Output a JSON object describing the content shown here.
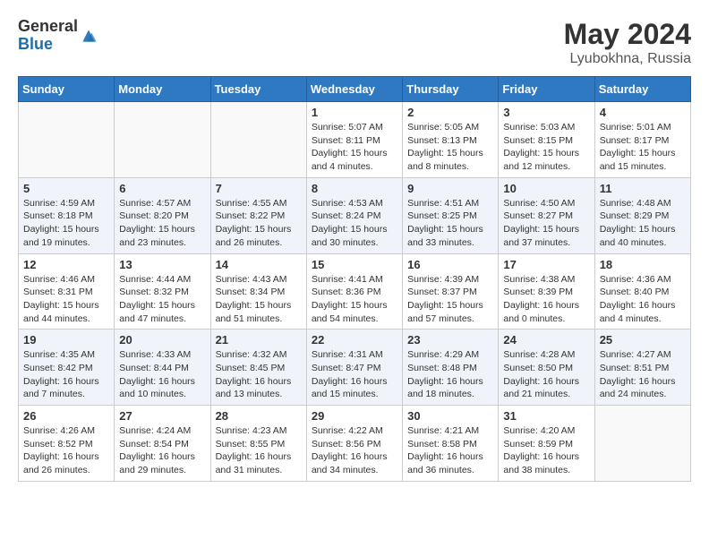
{
  "logo": {
    "general": "General",
    "blue": "Blue"
  },
  "title": "May 2024",
  "location": "Lyubokhna, Russia",
  "days_of_week": [
    "Sunday",
    "Monday",
    "Tuesday",
    "Wednesday",
    "Thursday",
    "Friday",
    "Saturday"
  ],
  "weeks": [
    [
      {
        "day": "",
        "sunrise": "",
        "sunset": "",
        "daylight": ""
      },
      {
        "day": "",
        "sunrise": "",
        "sunset": "",
        "daylight": ""
      },
      {
        "day": "",
        "sunrise": "",
        "sunset": "",
        "daylight": ""
      },
      {
        "day": "1",
        "sunrise": "Sunrise: 5:07 AM",
        "sunset": "Sunset: 8:11 PM",
        "daylight": "Daylight: 15 hours and 4 minutes."
      },
      {
        "day": "2",
        "sunrise": "Sunrise: 5:05 AM",
        "sunset": "Sunset: 8:13 PM",
        "daylight": "Daylight: 15 hours and 8 minutes."
      },
      {
        "day": "3",
        "sunrise": "Sunrise: 5:03 AM",
        "sunset": "Sunset: 8:15 PM",
        "daylight": "Daylight: 15 hours and 12 minutes."
      },
      {
        "day": "4",
        "sunrise": "Sunrise: 5:01 AM",
        "sunset": "Sunset: 8:17 PM",
        "daylight": "Daylight: 15 hours and 15 minutes."
      }
    ],
    [
      {
        "day": "5",
        "sunrise": "Sunrise: 4:59 AM",
        "sunset": "Sunset: 8:18 PM",
        "daylight": "Daylight: 15 hours and 19 minutes."
      },
      {
        "day": "6",
        "sunrise": "Sunrise: 4:57 AM",
        "sunset": "Sunset: 8:20 PM",
        "daylight": "Daylight: 15 hours and 23 minutes."
      },
      {
        "day": "7",
        "sunrise": "Sunrise: 4:55 AM",
        "sunset": "Sunset: 8:22 PM",
        "daylight": "Daylight: 15 hours and 26 minutes."
      },
      {
        "day": "8",
        "sunrise": "Sunrise: 4:53 AM",
        "sunset": "Sunset: 8:24 PM",
        "daylight": "Daylight: 15 hours and 30 minutes."
      },
      {
        "day": "9",
        "sunrise": "Sunrise: 4:51 AM",
        "sunset": "Sunset: 8:25 PM",
        "daylight": "Daylight: 15 hours and 33 minutes."
      },
      {
        "day": "10",
        "sunrise": "Sunrise: 4:50 AM",
        "sunset": "Sunset: 8:27 PM",
        "daylight": "Daylight: 15 hours and 37 minutes."
      },
      {
        "day": "11",
        "sunrise": "Sunrise: 4:48 AM",
        "sunset": "Sunset: 8:29 PM",
        "daylight": "Daylight: 15 hours and 40 minutes."
      }
    ],
    [
      {
        "day": "12",
        "sunrise": "Sunrise: 4:46 AM",
        "sunset": "Sunset: 8:31 PM",
        "daylight": "Daylight: 15 hours and 44 minutes."
      },
      {
        "day": "13",
        "sunrise": "Sunrise: 4:44 AM",
        "sunset": "Sunset: 8:32 PM",
        "daylight": "Daylight: 15 hours and 47 minutes."
      },
      {
        "day": "14",
        "sunrise": "Sunrise: 4:43 AM",
        "sunset": "Sunset: 8:34 PM",
        "daylight": "Daylight: 15 hours and 51 minutes."
      },
      {
        "day": "15",
        "sunrise": "Sunrise: 4:41 AM",
        "sunset": "Sunset: 8:36 PM",
        "daylight": "Daylight: 15 hours and 54 minutes."
      },
      {
        "day": "16",
        "sunrise": "Sunrise: 4:39 AM",
        "sunset": "Sunset: 8:37 PM",
        "daylight": "Daylight: 15 hours and 57 minutes."
      },
      {
        "day": "17",
        "sunrise": "Sunrise: 4:38 AM",
        "sunset": "Sunset: 8:39 PM",
        "daylight": "Daylight: 16 hours and 0 minutes."
      },
      {
        "day": "18",
        "sunrise": "Sunrise: 4:36 AM",
        "sunset": "Sunset: 8:40 PM",
        "daylight": "Daylight: 16 hours and 4 minutes."
      }
    ],
    [
      {
        "day": "19",
        "sunrise": "Sunrise: 4:35 AM",
        "sunset": "Sunset: 8:42 PM",
        "daylight": "Daylight: 16 hours and 7 minutes."
      },
      {
        "day": "20",
        "sunrise": "Sunrise: 4:33 AM",
        "sunset": "Sunset: 8:44 PM",
        "daylight": "Daylight: 16 hours and 10 minutes."
      },
      {
        "day": "21",
        "sunrise": "Sunrise: 4:32 AM",
        "sunset": "Sunset: 8:45 PM",
        "daylight": "Daylight: 16 hours and 13 minutes."
      },
      {
        "day": "22",
        "sunrise": "Sunrise: 4:31 AM",
        "sunset": "Sunset: 8:47 PM",
        "daylight": "Daylight: 16 hours and 15 minutes."
      },
      {
        "day": "23",
        "sunrise": "Sunrise: 4:29 AM",
        "sunset": "Sunset: 8:48 PM",
        "daylight": "Daylight: 16 hours and 18 minutes."
      },
      {
        "day": "24",
        "sunrise": "Sunrise: 4:28 AM",
        "sunset": "Sunset: 8:50 PM",
        "daylight": "Daylight: 16 hours and 21 minutes."
      },
      {
        "day": "25",
        "sunrise": "Sunrise: 4:27 AM",
        "sunset": "Sunset: 8:51 PM",
        "daylight": "Daylight: 16 hours and 24 minutes."
      }
    ],
    [
      {
        "day": "26",
        "sunrise": "Sunrise: 4:26 AM",
        "sunset": "Sunset: 8:52 PM",
        "daylight": "Daylight: 16 hours and 26 minutes."
      },
      {
        "day": "27",
        "sunrise": "Sunrise: 4:24 AM",
        "sunset": "Sunset: 8:54 PM",
        "daylight": "Daylight: 16 hours and 29 minutes."
      },
      {
        "day": "28",
        "sunrise": "Sunrise: 4:23 AM",
        "sunset": "Sunset: 8:55 PM",
        "daylight": "Daylight: 16 hours and 31 minutes."
      },
      {
        "day": "29",
        "sunrise": "Sunrise: 4:22 AM",
        "sunset": "Sunset: 8:56 PM",
        "daylight": "Daylight: 16 hours and 34 minutes."
      },
      {
        "day": "30",
        "sunrise": "Sunrise: 4:21 AM",
        "sunset": "Sunset: 8:58 PM",
        "daylight": "Daylight: 16 hours and 36 minutes."
      },
      {
        "day": "31",
        "sunrise": "Sunrise: 4:20 AM",
        "sunset": "Sunset: 8:59 PM",
        "daylight": "Daylight: 16 hours and 38 minutes."
      },
      {
        "day": "",
        "sunrise": "",
        "sunset": "",
        "daylight": ""
      }
    ]
  ]
}
